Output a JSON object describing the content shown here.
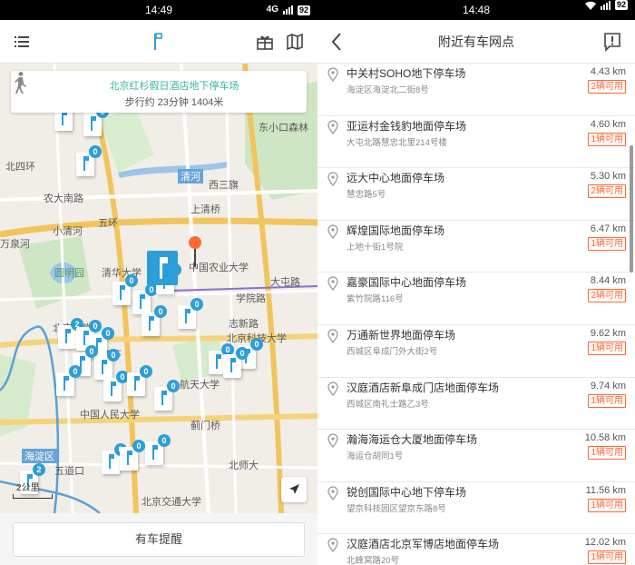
{
  "left": {
    "status": {
      "time": "14:49",
      "network": "4G",
      "battery": "92"
    },
    "header": {
      "menu_icon": "menu-icon",
      "logo_icon": "parking-flag-icon",
      "gift_icon": "gift-icon",
      "map_icon": "map-icon"
    },
    "route_card": {
      "title": "北京红杉假日酒店地下停车场",
      "subtitle": "步行约 23分钟 1404米"
    },
    "map_labels": [
      "东小口森林",
      "北四环",
      "农大南路",
      "五环",
      "小清河",
      "上清桥",
      "西三旗",
      "清河",
      "清华大学",
      "中国农业大学",
      "圆明园",
      "北京科技大学",
      "志新路",
      "万泉河",
      "北京大学",
      "中国人民大学",
      "航天大学",
      "蓟门桥",
      "海淀区",
      "北京交通大学",
      "北师大",
      "大屯路",
      "四环",
      "五道口",
      "学院路"
    ],
    "marker_counts": [
      "0",
      "0",
      "0",
      "0",
      "0",
      "0",
      "0",
      "2",
      "0",
      "0",
      "0",
      "0",
      "0",
      "0",
      "0",
      "0",
      "0",
      "0",
      "0",
      "0",
      "2",
      "0",
      "0",
      "0"
    ],
    "scale": "2公里",
    "remind_button": "有车提醒",
    "colors": {
      "accent": "#2d9ed8",
      "route_text": "#3bb6a0",
      "destination_pin": "#ff6a33"
    }
  },
  "right": {
    "status": {
      "time": "14:48",
      "battery": "92"
    },
    "title": "附近有车网点",
    "items": [
      {
        "name": "中关村SOHO地下停车场",
        "address": "海淀区海淀北二街8号",
        "distance": "4.43 km",
        "available": "2辆可用"
      },
      {
        "name": "亚运村金钱豹地面停车场",
        "address": "大屯北路慧忠北里214号楼",
        "distance": "4.60 km",
        "available": "1辆可用"
      },
      {
        "name": "远大中心地面停车场",
        "address": "慧忠路5号",
        "distance": "5.30 km",
        "available": "2辆可用"
      },
      {
        "name": "辉煌国际地面停车场",
        "address": "上地十街1号院",
        "distance": "6.47 km",
        "available": "1辆可用"
      },
      {
        "name": "嘉豪国际中心地面停车场",
        "address": "紫竹院路116号",
        "distance": "8.44 km",
        "available": "2辆可用"
      },
      {
        "name": "万通新世界地面停车场",
        "address": "西城区阜成门外大街2号",
        "distance": "9.62 km",
        "available": "1辆可用"
      },
      {
        "name": "汉庭酒店新阜成门店地面停车场",
        "address": "西城区南礼士路乙3号",
        "distance": "9.74 km",
        "available": "1辆可用"
      },
      {
        "name": "瀚海海运仓大厦地面停车场",
        "address": "海运仓胡同1号",
        "distance": "10.58 km",
        "available": "1辆可用"
      },
      {
        "name": "锐创国际中心地下停车场",
        "address": "望京科技园区望京东路8号",
        "distance": "11.56 km",
        "available": "1辆可用"
      },
      {
        "name": "汉庭酒店北京军博店地面停车场",
        "address": "北蜂窝路20号",
        "distance": "12.02 km",
        "available": "1辆可用"
      }
    ],
    "colors": {
      "available_border": "#ff6633"
    }
  }
}
